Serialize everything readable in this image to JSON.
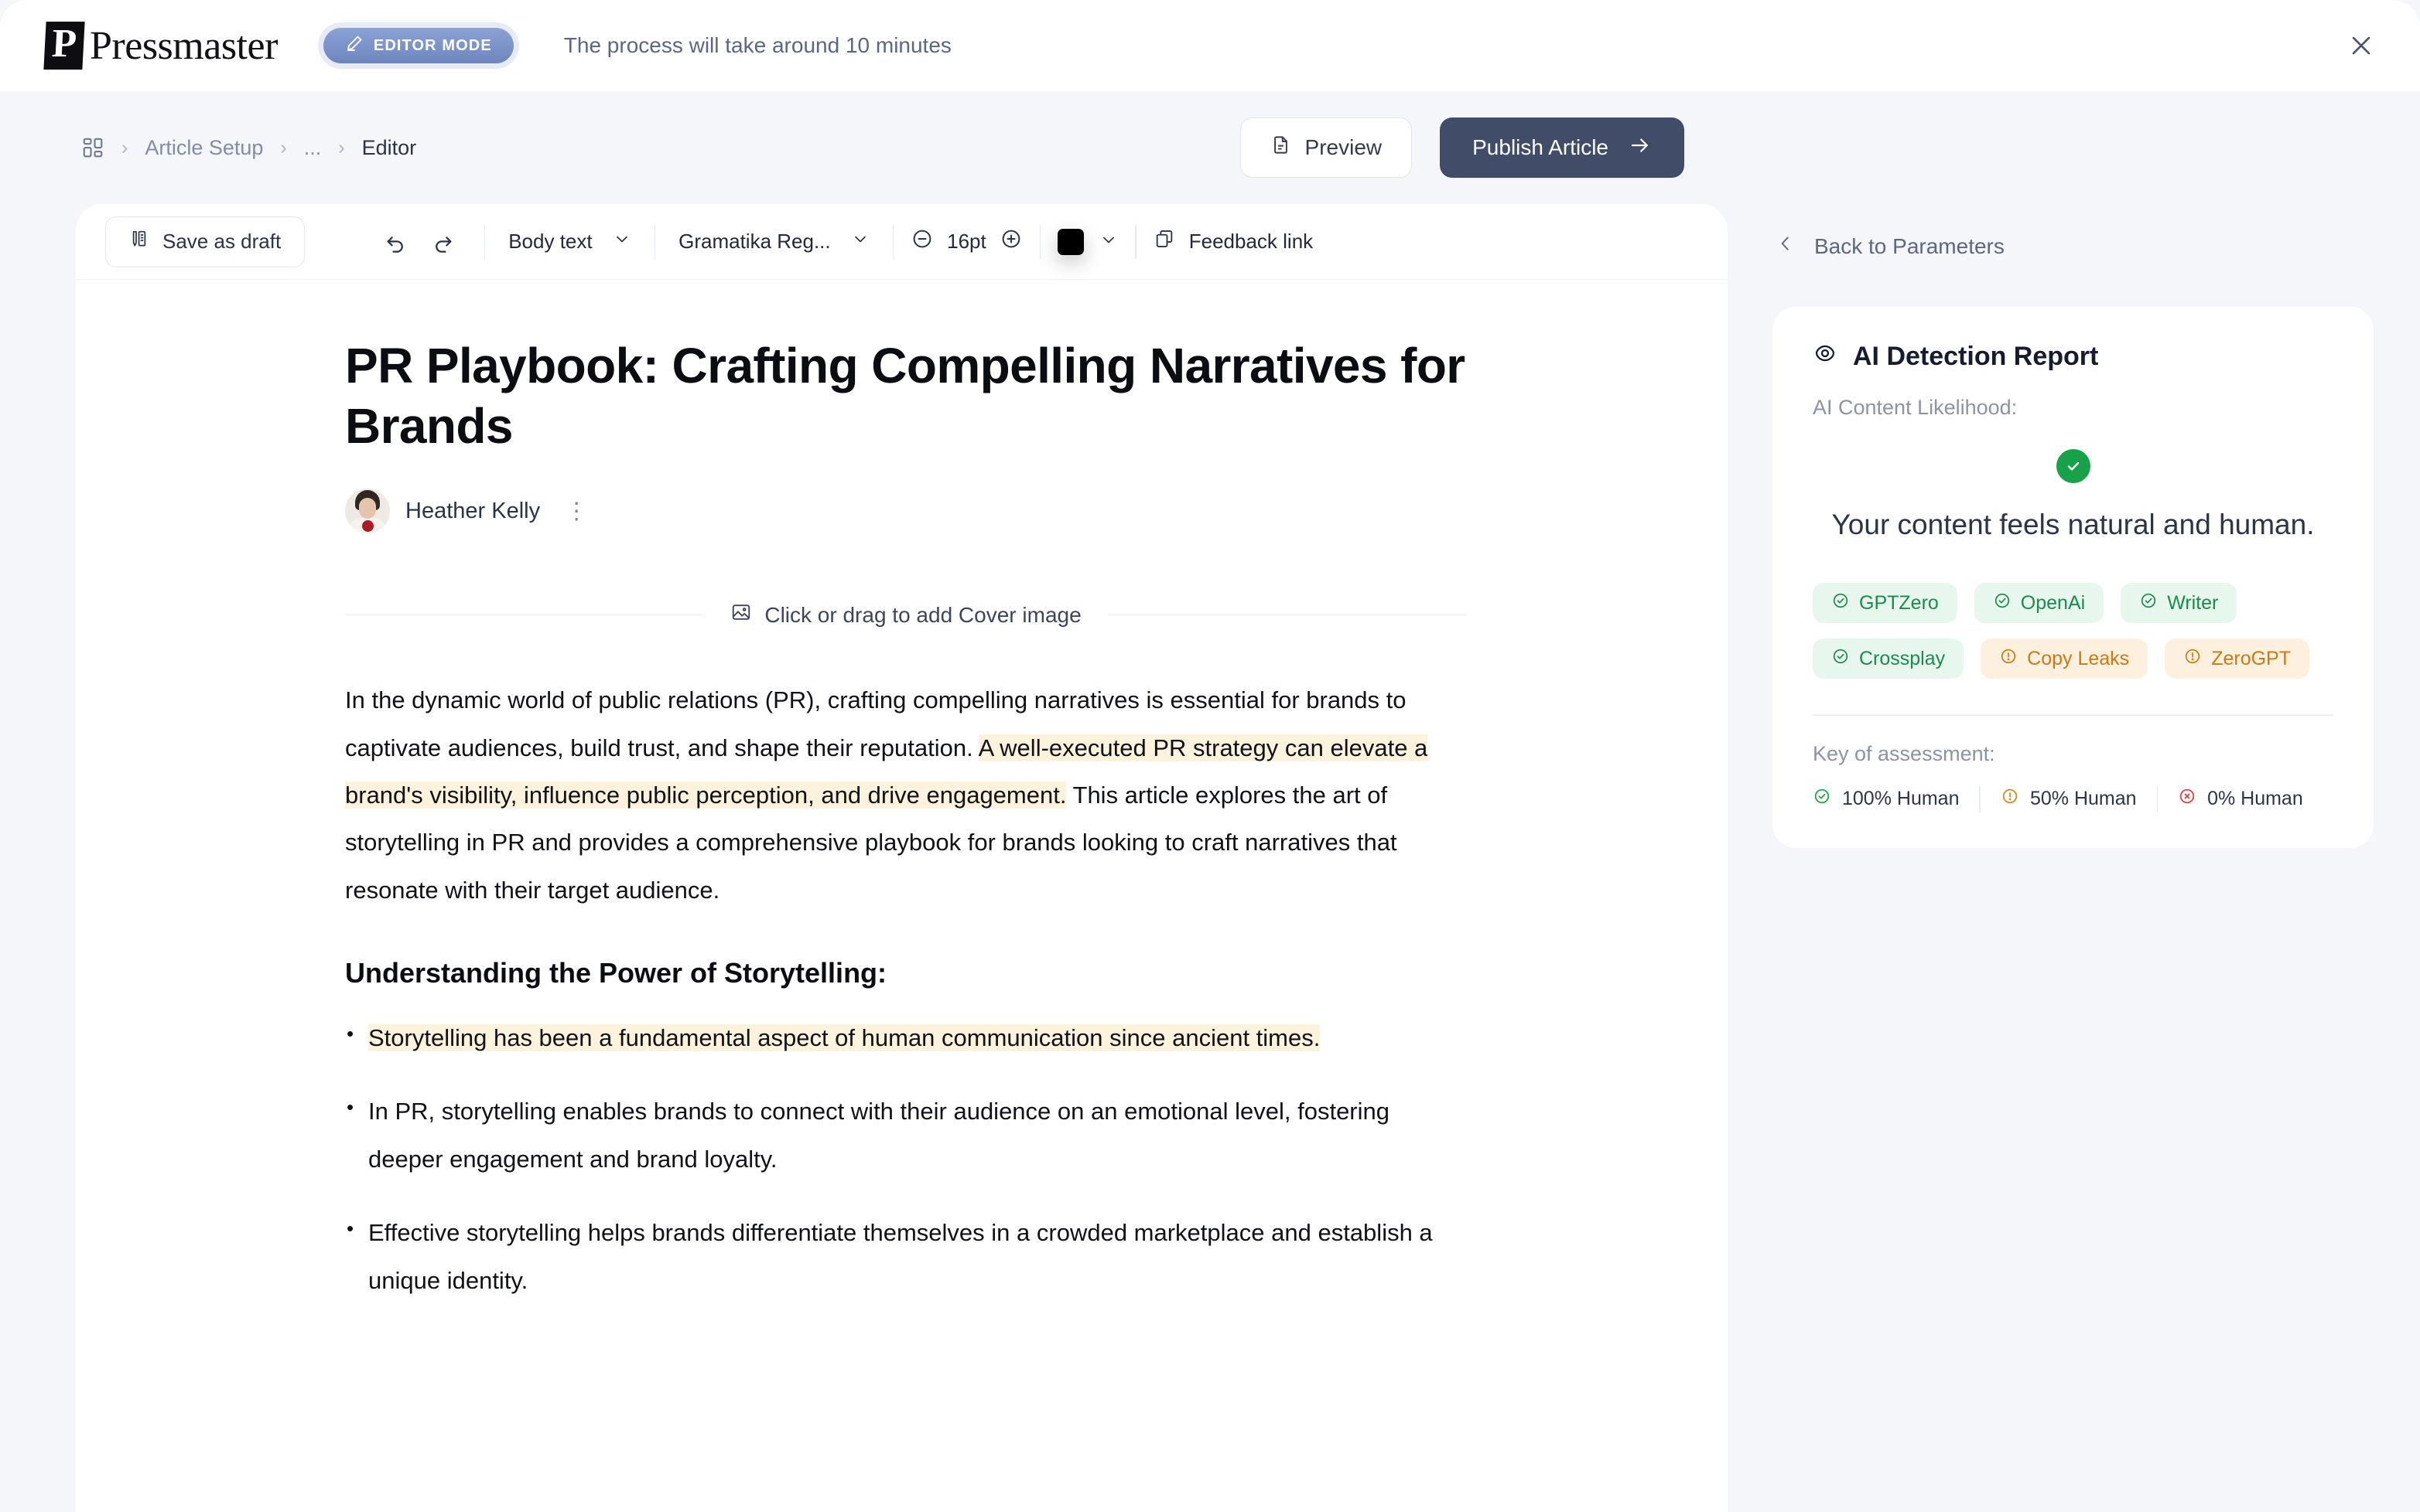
{
  "topbar": {
    "brand_initial": "P",
    "brand_name": "Pressmaster",
    "editor_mode_label": "EDITOR MODE",
    "process_note": "The process will take around 10 minutes",
    "close_icon": "close-icon"
  },
  "breadcrumb": {
    "home_icon": "dashboard-grid-icon",
    "items": [
      "Article Setup",
      "...",
      "Editor"
    ],
    "separator": "›"
  },
  "actions": {
    "preview_label": "Preview",
    "publish_label": "Publish Article"
  },
  "toolbar": {
    "save_draft_label": "Save as draft",
    "undo_icon": "undo-arrow-icon",
    "redo_icon": "redo-arrow-icon",
    "style_select": "Body text",
    "font_select": "Gramatika Reg...",
    "font_size": "16pt",
    "decrease_icon": "minus-circle-icon",
    "increase_icon": "plus-circle-icon",
    "text_color": "#000000",
    "feedback_link_label": "Feedback link"
  },
  "document": {
    "title": "PR Playbook: Crafting Compelling Narratives for Brands",
    "author": "Heather Kelly",
    "author_menu_icon": "kebab-menu-icon",
    "cover_placeholder": "Click or drag to add Cover image",
    "paragraph": {
      "before": "In the dynamic world of public relations (PR), crafting compelling narratives is essential for brands to captivate audiences, build trust, and shape their reputation. ",
      "highlight": "A well-executed PR strategy can elevate a brand's visibility, influence public perception, and drive engagement.",
      "after": " This article explores the art of storytelling in PR and provides a comprehensive playbook for brands looking to craft narratives that resonate with their target audience."
    },
    "heading": "Understanding the Power of Storytelling:",
    "bullets": [
      {
        "text": "Storytelling has been a fundamental aspect of human communication since ancient times.",
        "highlighted": true
      },
      {
        "text": "In PR, storytelling enables brands to connect with their audience on an emotional level, fostering deeper engagement and brand loyalty.",
        "highlighted": false
      },
      {
        "text": "Effective storytelling helps brands differentiate themselves in a crowded marketplace and establish a unique identity.",
        "highlighted": false
      }
    ]
  },
  "right_panel": {
    "back_label": "Back to Parameters",
    "report_title": "AI Detection Report",
    "report_icon": "eye-icon",
    "likelihood_label": "AI Content Likelihood:",
    "verdict_text": "Your content feels natural and human.",
    "verdict_status": "pass",
    "detectors": [
      {
        "name": "GPTZero",
        "status": "pass"
      },
      {
        "name": "OpenAi",
        "status": "pass"
      },
      {
        "name": "Writer",
        "status": "pass"
      },
      {
        "name": "Crossplay",
        "status": "pass"
      },
      {
        "name": "Copy Leaks",
        "status": "warn"
      },
      {
        "name": "ZeroGPT",
        "status": "warn"
      }
    ],
    "key_title": "Key of assessment:",
    "key_items": [
      {
        "label": "100% Human",
        "status": "pass"
      },
      {
        "label": "50% Human",
        "status": "warn"
      },
      {
        "label": "0% Human",
        "status": "fail"
      }
    ]
  },
  "colors": {
    "accent_blue": "#7d95cd",
    "publish_navy": "#414c68",
    "highlight": "#fdf3dd",
    "pass_green": "#17a24a",
    "warn_amber": "#d2891b",
    "fail_red": "#e0393e",
    "page_bg": "#f4f6fa"
  }
}
